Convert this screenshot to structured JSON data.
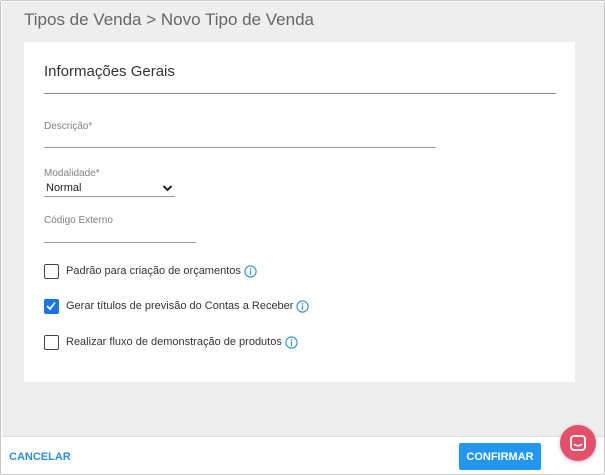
{
  "header": {
    "title": "Tipos de Venda > Novo Tipo de Venda"
  },
  "section": {
    "title": "Informações Gerais"
  },
  "fields": {
    "descricao": {
      "label": "Descrição*",
      "value": ""
    },
    "modalidade": {
      "label": "Modalidade*",
      "value": "Normal"
    },
    "codigo_externo": {
      "label": "Código Externo",
      "value": ""
    }
  },
  "checkboxes": [
    {
      "label": "Padrão para criação de orçamentos",
      "checked": false
    },
    {
      "label": "Gerar títulos de previsão do Contas a Receber",
      "checked": true
    },
    {
      "label": "Realizar fluxo de demonstração de produtos",
      "checked": false
    }
  ],
  "footer": {
    "cancel_label": "CANCELAR",
    "confirm_label": "CONFIRMAR"
  },
  "colors": {
    "accent": "#2196f3",
    "checkbox_checked": "#1a73e8",
    "link": "#2a8fd6",
    "chat_fab": "#e4506a",
    "background": "#eeeeee"
  },
  "icons": {
    "info": "info-icon",
    "chevron": "chevron-down-icon",
    "chat": "chat-icon",
    "check": "check-icon"
  }
}
